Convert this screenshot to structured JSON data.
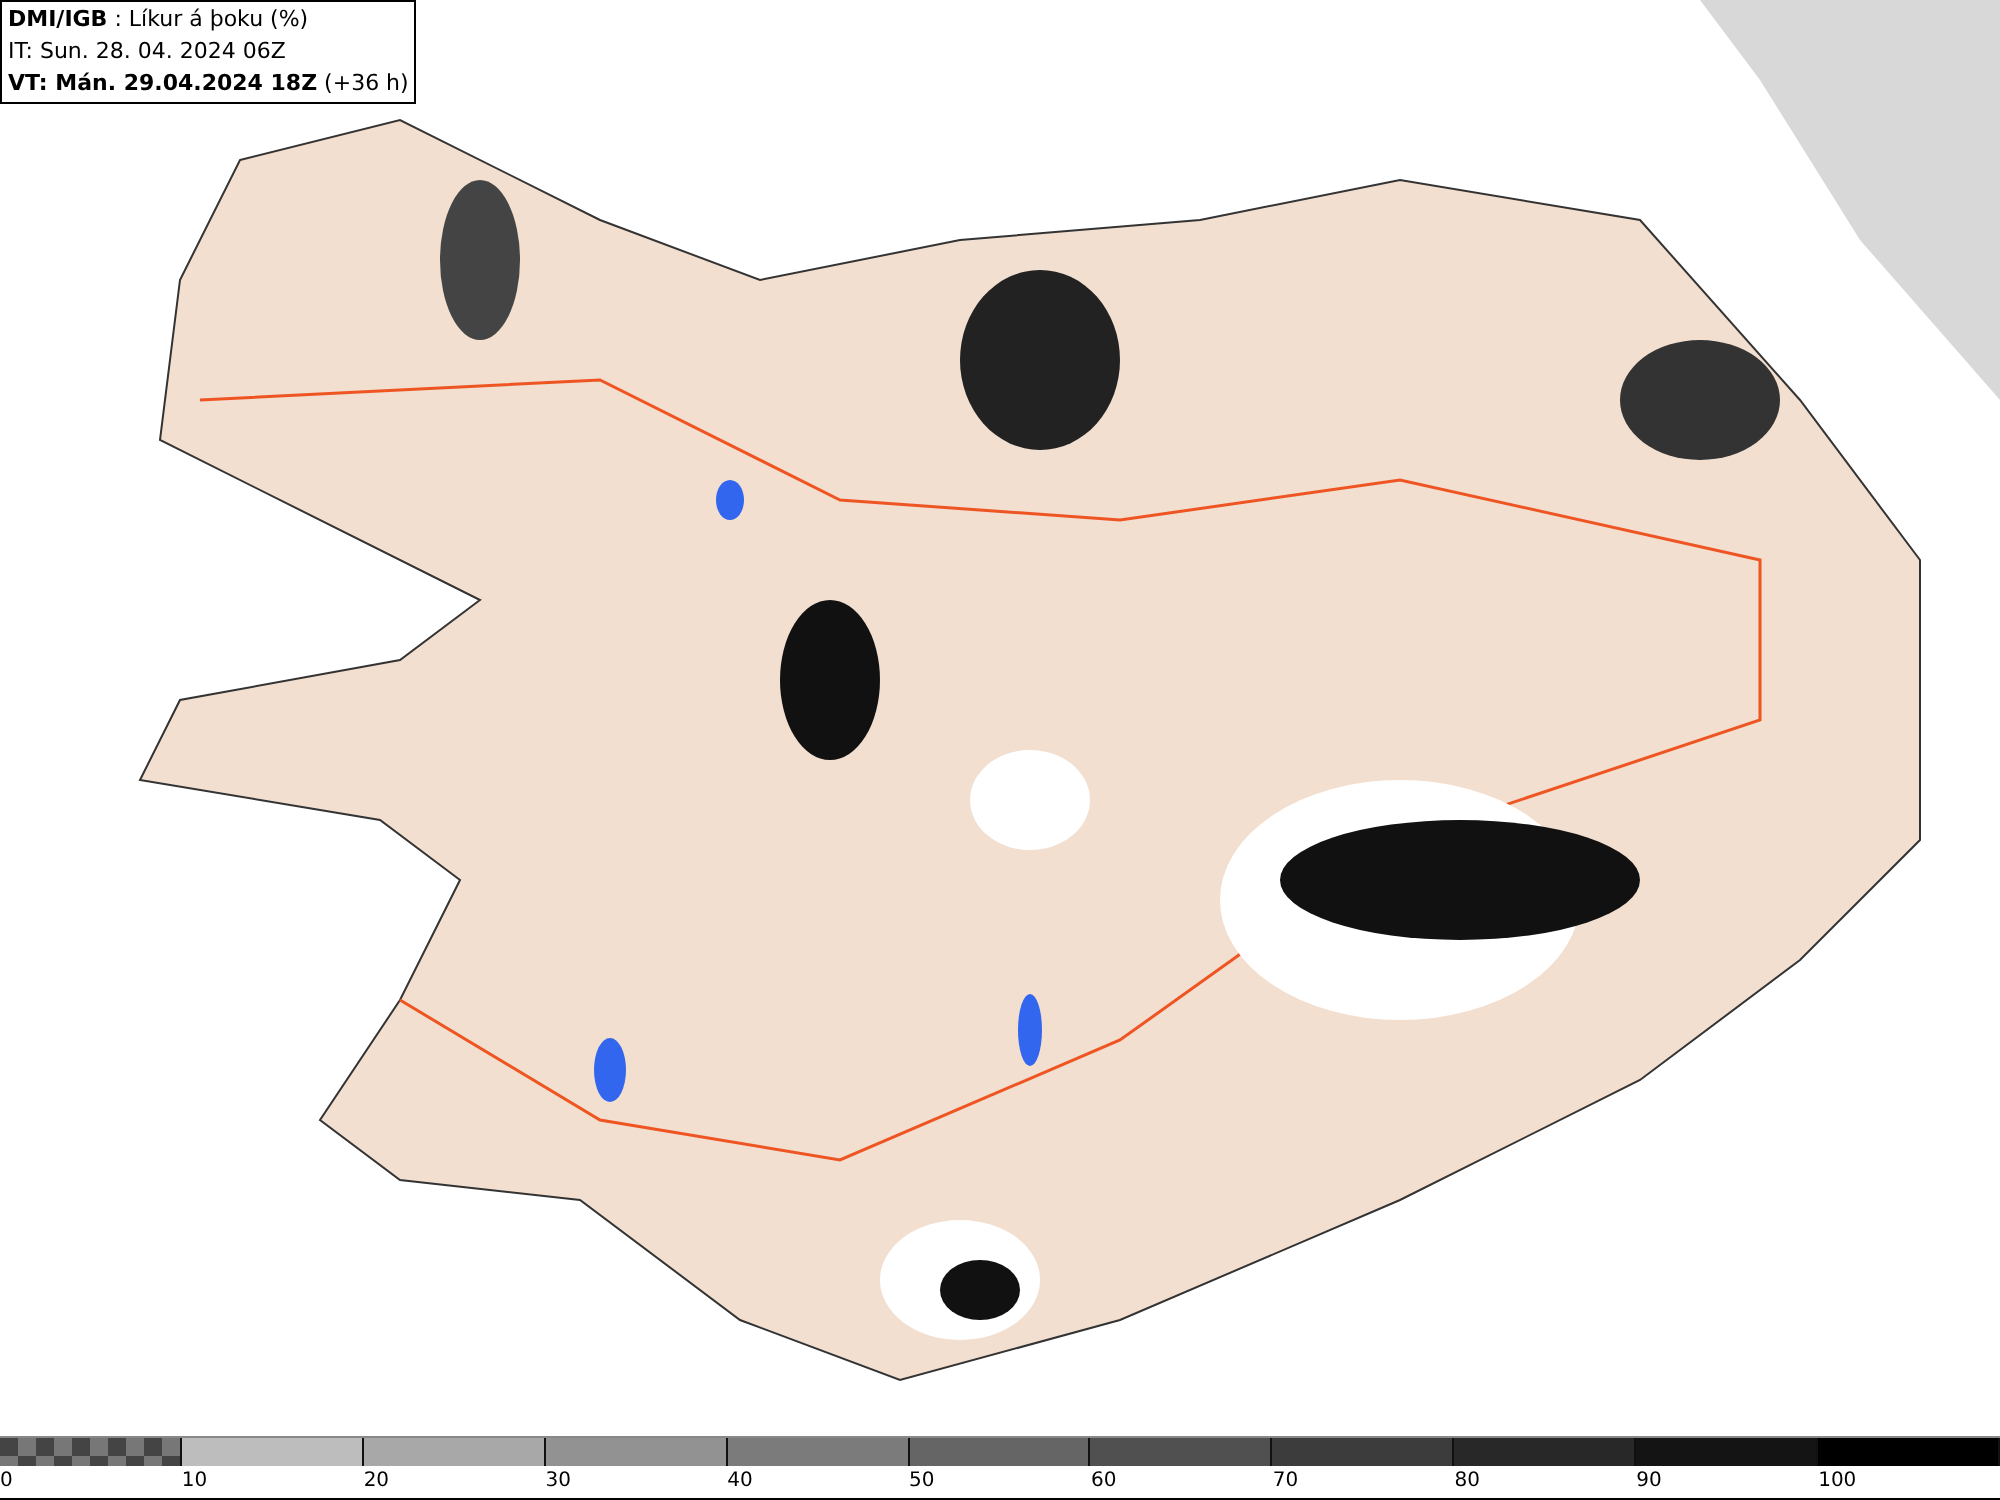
{
  "header": {
    "lines": [
      "**DMI/IGB** : Líkur á þoku (%)",
      "IT: Sun. 28. 04. 2024 06Z",
      "**VT: Mán. 29.04.2024 18Z** (+36 h)"
    ]
  },
  "legend": {
    "segments": [
      {
        "kind": "checkered",
        "color": "#777777"
      },
      {
        "kind": "solid",
        "color": "#bdbdbd"
      },
      {
        "kind": "solid",
        "color": "#a8a8a8"
      },
      {
        "kind": "solid",
        "color": "#929292"
      },
      {
        "kind": "solid",
        "color": "#7b7b7b"
      },
      {
        "kind": "solid",
        "color": "#656565"
      },
      {
        "kind": "solid",
        "color": "#505050"
      },
      {
        "kind": "solid",
        "color": "#3c3c3c"
      },
      {
        "kind": "solid",
        "color": "#282828"
      },
      {
        "kind": "solid",
        "color": "#141414"
      },
      {
        "kind": "solid",
        "color": "#000000"
      }
    ],
    "labels": [
      "0",
      "10",
      "20",
      "30",
      "40",
      "50",
      "60",
      "70",
      "80",
      "90",
      "100"
    ]
  }
}
